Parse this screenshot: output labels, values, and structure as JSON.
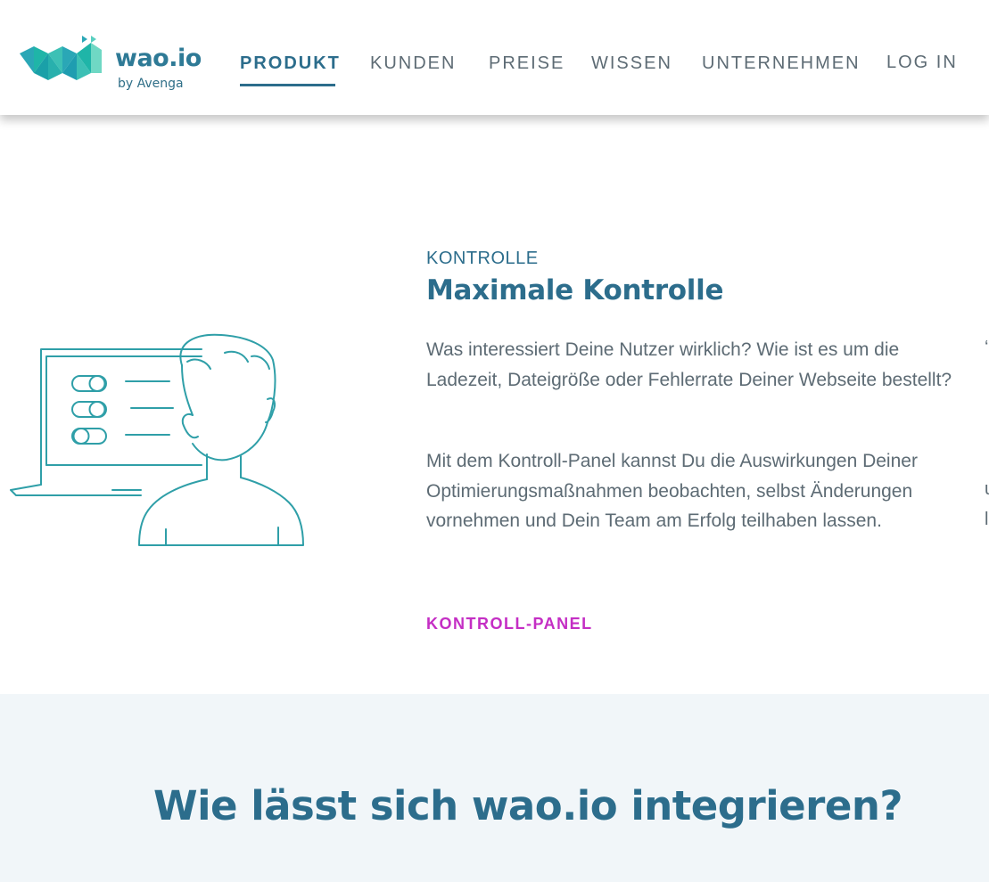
{
  "brand": {
    "name": "wao.io",
    "tagline": "by Avenga",
    "colors": {
      "primary": "#2c6d8c",
      "teal": "#1fb5a8",
      "accent": "#c42ec4"
    }
  },
  "nav": {
    "items": [
      {
        "label": "PRODUKT",
        "active": true
      },
      {
        "label": "KUNDEN",
        "active": false
      },
      {
        "label": "PREISE",
        "active": false
      },
      {
        "label": "WISSEN",
        "active": false
      },
      {
        "label": "UNTERNEHMEN",
        "active": false
      },
      {
        "label": "LOG IN",
        "active": false
      }
    ]
  },
  "feature": {
    "illustration_icon": "person-at-laptop-with-toggles-illustration",
    "eyebrow": "KONTROLLE",
    "title": "Maximale Kontrolle",
    "paragraphs": [
      "Was interessiert Deine Nutzer wirklich? Wie ist es um die Ladezeit, Dateigröße oder Fehlerrate Deiner Webseite bestellt?",
      "Mit dem Kontroll-Panel kannst Du die Auswirkungen Deiner Optimierungsmaßnahmen beobachten, selbst Änderungen vornehmen und Dein Team am Erfolg teilhaben lassen."
    ],
    "link": "KONTROLL-PANEL"
  },
  "integration": {
    "heading": "Wie lässt sich wao.io integrieren?"
  }
}
